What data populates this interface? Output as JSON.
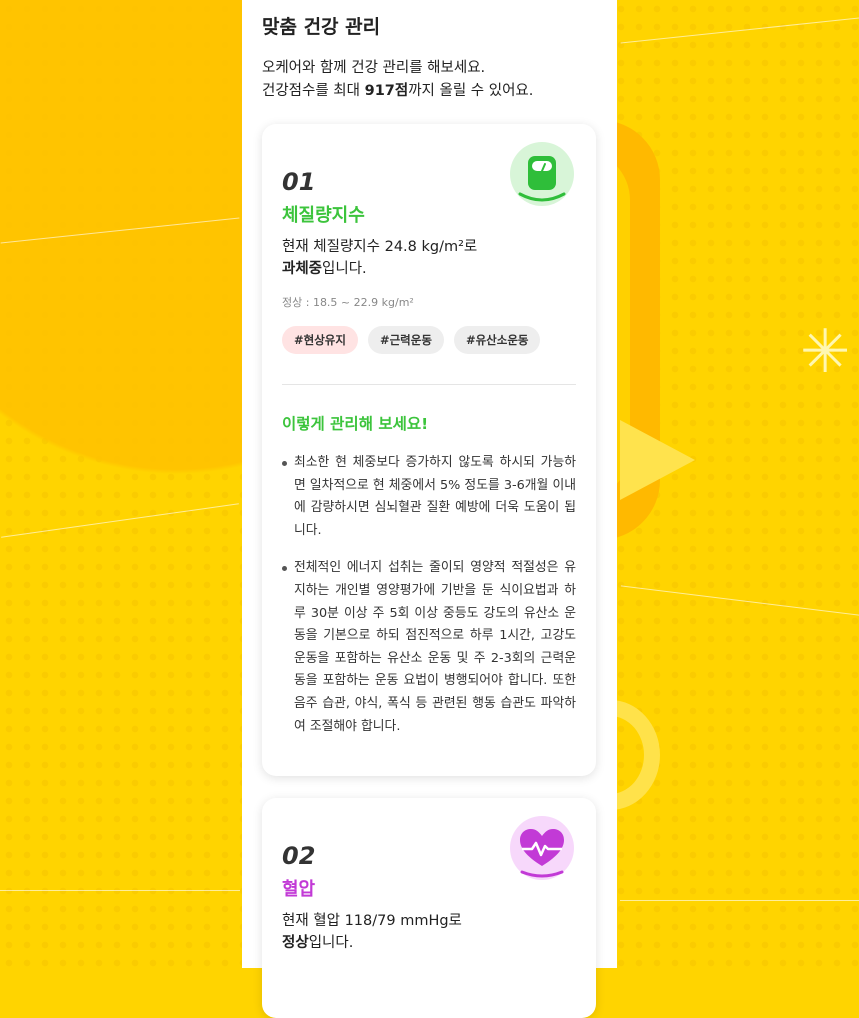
{
  "page": {
    "title": "맞춤 건강 관리",
    "intro_line1": "오케어와 함께 건강 관리를 해보세요.",
    "intro_line2_prefix": "건강점수를 최대 ",
    "intro_line2_score": "917점",
    "intro_line2_suffix": "까지 올릴 수 있어요."
  },
  "cards": [
    {
      "number": "01",
      "name": "체질량지수",
      "icon": "scale-icon",
      "status_line1": "현재 체질량지수 24.8 kg/m²로",
      "status_bold": "과체중",
      "status_suffix": "입니다.",
      "normal_range": "정상 : 18.5 ~ 22.9 kg/m²",
      "tags": [
        "#현상유지",
        "#근력운동",
        "#유산소운동"
      ],
      "advice_title": "이렇게 관리해 보세요!",
      "advice": [
        "최소한 현 체중보다 증가하지 않도록 하시되 가능하면 일차적으로 현 체중에서 5% 정도를 3-6개월 이내에 감량하시면 심뇌혈관 질환 예방에 더욱 도움이 됩니다.",
        "전체적인 에너지 섭취는 줄이되 영양적 적절성은 유지하는 개인별 영양평가에 기반을 둔 식이요법과 하루 30분 이상 주 5회 이상 중등도 강도의 유산소 운동을 기본으로 하되 점진적으로 하루 1시간, 고강도 운동을 포함하는 유산소 운동 및 주 2-3회의 근력운동을 포함하는 운동 요법이 병행되어야 합니다. 또한 음주 습관, 야식, 폭식 등 관련된 행동 습관도 파악하여 조절해야 합니다."
      ]
    },
    {
      "number": "02",
      "name": "혈압",
      "icon": "heart-pulse-icon",
      "status_line1": "현재 혈압 118/79 mmHg로",
      "status_bold": "정상",
      "status_suffix": "입니다."
    }
  ],
  "colors": {
    "background": "#ffd400",
    "bmi_accent": "#3cc43c",
    "bp_accent": "#c23ad6"
  }
}
